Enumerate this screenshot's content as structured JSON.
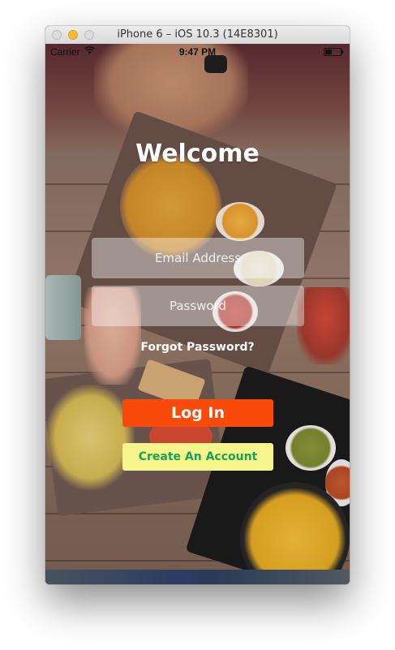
{
  "window": {
    "title": "iPhone 6 – iOS 10.3 (14E8301)"
  },
  "status_bar": {
    "carrier": "Carrier",
    "wifi_icon": "wifi-icon",
    "time": "9:47 PM",
    "battery_level": 0.45
  },
  "login": {
    "heading": "Welcome",
    "email_placeholder": "Email Address",
    "email_value": "",
    "password_placeholder": "Password",
    "password_value": "",
    "forgot_password": "Forgot Password?",
    "login_label": "Log In",
    "create_account_label": "Create An Account"
  },
  "colors": {
    "login_button": "#f84b0a",
    "create_button_bg": "#f6f58c",
    "create_button_text": "#17a257"
  }
}
